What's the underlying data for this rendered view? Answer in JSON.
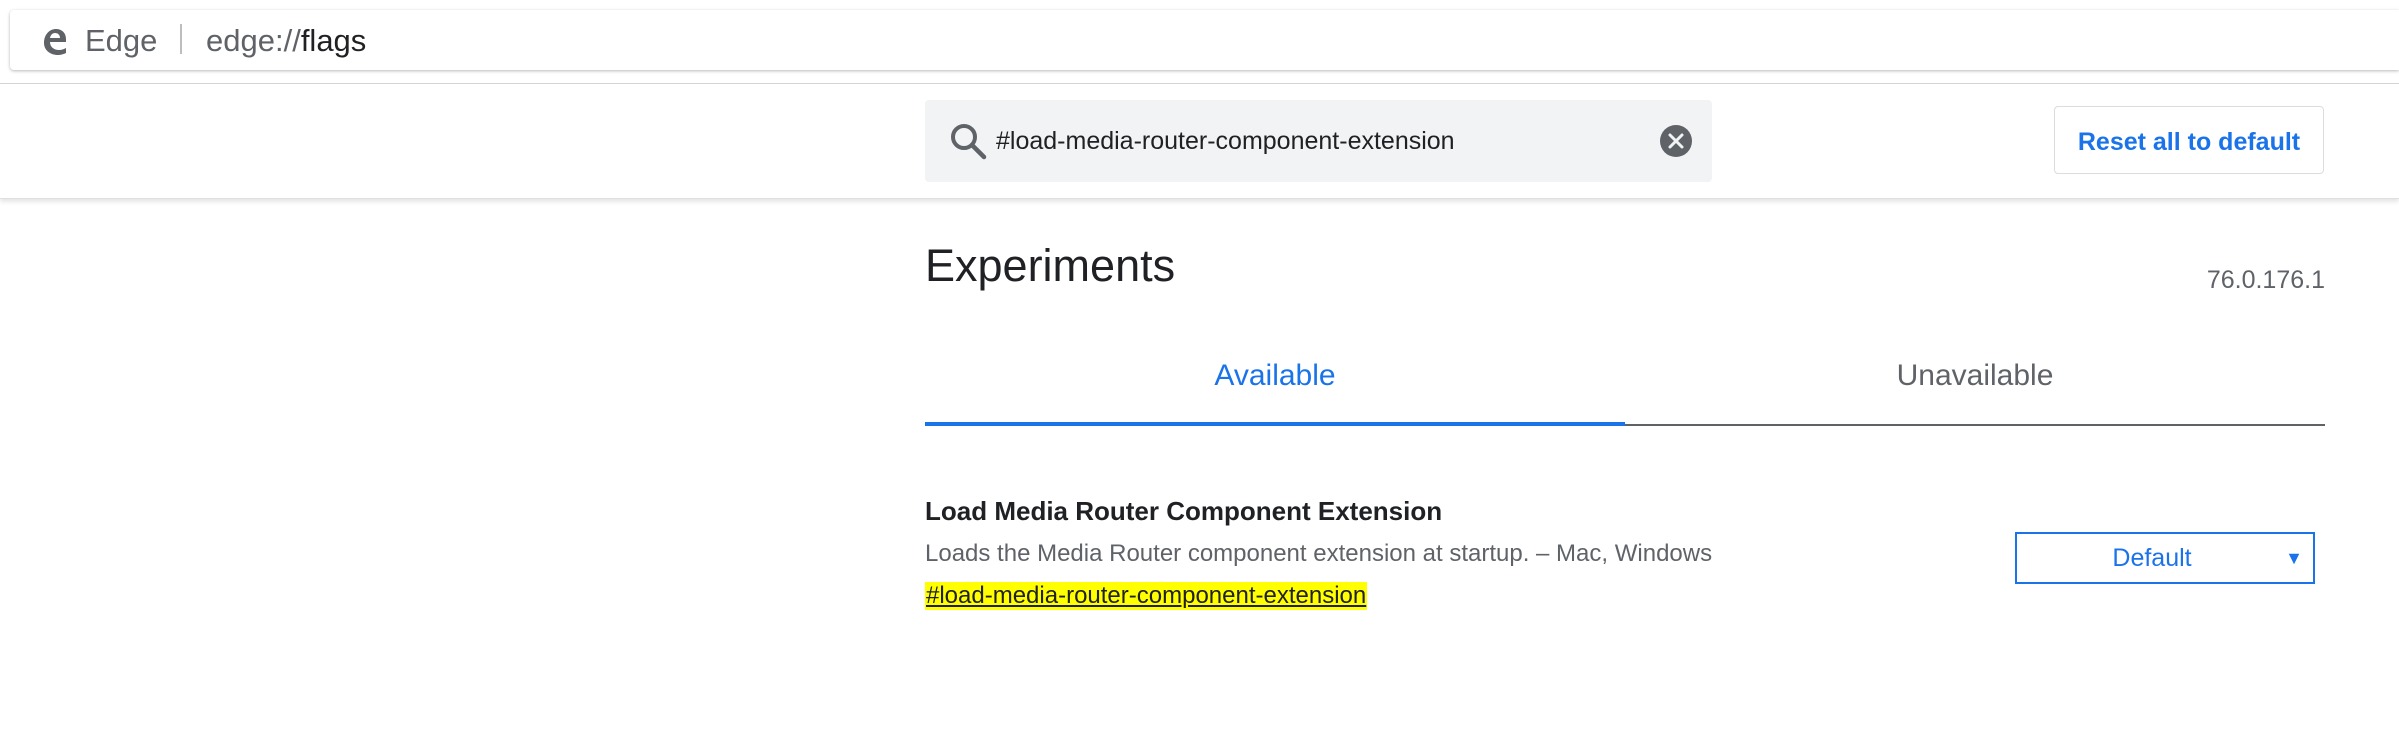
{
  "browser": {
    "name": "Edge",
    "url_scheme": "edge://",
    "url_path": "flags"
  },
  "header": {
    "search_value": "#load-media-router-component-extension",
    "reset_label": "Reset all to default"
  },
  "main": {
    "title": "Experiments",
    "version": "76.0.176.1",
    "tabs": [
      {
        "label": "Available",
        "selected": true
      },
      {
        "label": "Unavailable",
        "selected": false
      }
    ],
    "experiments": [
      {
        "title": "Load Media Router Component Extension",
        "description": "Loads the Media Router component extension at startup. – Mac, Windows",
        "link": "#load-media-router-component-extension",
        "selected_option": "Default"
      }
    ]
  },
  "icons": {
    "browser_logo": "edge-logo-icon",
    "search": "search-icon",
    "clear": "close-circle-icon",
    "dropdown": "caret-down-icon"
  },
  "colors": {
    "accent": "#1a73e8",
    "highlight": "#ffff00",
    "search_background": "#f1f3f4",
    "text_primary": "#202124",
    "text_secondary": "#5f6368"
  }
}
